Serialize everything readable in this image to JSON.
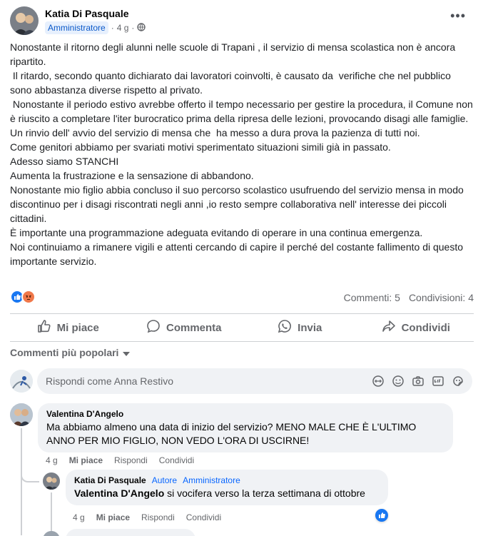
{
  "post": {
    "author": "Katia Di Pasquale",
    "role": "Amministratore",
    "time": "4 g",
    "separator": "·",
    "more_label": "•••",
    "body": "Nonostante il ritorno degli alunni nelle scuole di Trapani , il servizio di mensa scolastica non è ancora ripartito.\n Il ritardo, secondo quanto dichiarato dai lavoratori coinvolti, è causato da  verifiche che nel pubblico sono abbastanza diverse rispetto al privato.\n Nonostante il periodo estivo avrebbe offerto il tempo necessario per gestire la procedura, il Comune non è riuscito a completare l'iter burocratico prima della ripresa delle lezioni, provocando disagi alle famiglie.\nUn rinvio dell' avvio del servizio di mensa che  ha messo a dura prova la pazienza di tutti noi.\nCome genitori abbiamo per svariati motivi sperimentato situazioni simili già in passato.\nAdesso siamo STANCHI\nAumenta la frustrazione e la sensazione di abbandono.\nNonostante mio figlio abbia concluso il suo percorso scolastico usufruendo del servizio mensa in modo discontinuo per i disagi riscontrati negli anni ,io resto sempre collaborativa nell' interesse dei piccoli cittadini.\nÈ importante una programmazione adeguata evitando di operare in una continua emergenza.\nNoi continuiamo a rimanere vigili e attenti cercando di capire il perché del costante fallimento di questo importante servizio.",
    "reactions": [
      "like-icon",
      "angry-icon"
    ],
    "comments_count": "Commenti: 5",
    "shares_count": "Condivisioni: 4"
  },
  "actions": {
    "like": "Mi piace",
    "comment": "Commenta",
    "share_whatsapp": "Invia",
    "share": "Condividi"
  },
  "comments_section": {
    "sort_label": "Commenti più popolari",
    "reply_placeholder": "Rispondi come Anna Restivo"
  },
  "comments": [
    {
      "author": "Valentina D'Angelo",
      "text": "Ma abbiamo almeno una data di inizio del servizio? MENO MALE CHE È L'ULTIMO ANNO PER MIO FIGLIO, NON VEDO L'ORA DI USCIRNE!",
      "time": "4 g",
      "like": "Mi piace",
      "reply": "Rispondi",
      "share": "Condividi"
    },
    {
      "author": "Katia Di Pasquale",
      "tag_author": "Autore",
      "tag_admin": "Amministratore",
      "mention": "Valentina D'Angelo",
      "text": " si vocifera verso la terza settimana di ottobre",
      "time": "4 g",
      "like": "Mi piace",
      "reply": "Rispondi",
      "share": "Condividi"
    }
  ],
  "colors": {
    "accent": "#1877f2",
    "angry": "#f0784a",
    "muted": "#65676b",
    "bubble": "#f0f2f5"
  }
}
